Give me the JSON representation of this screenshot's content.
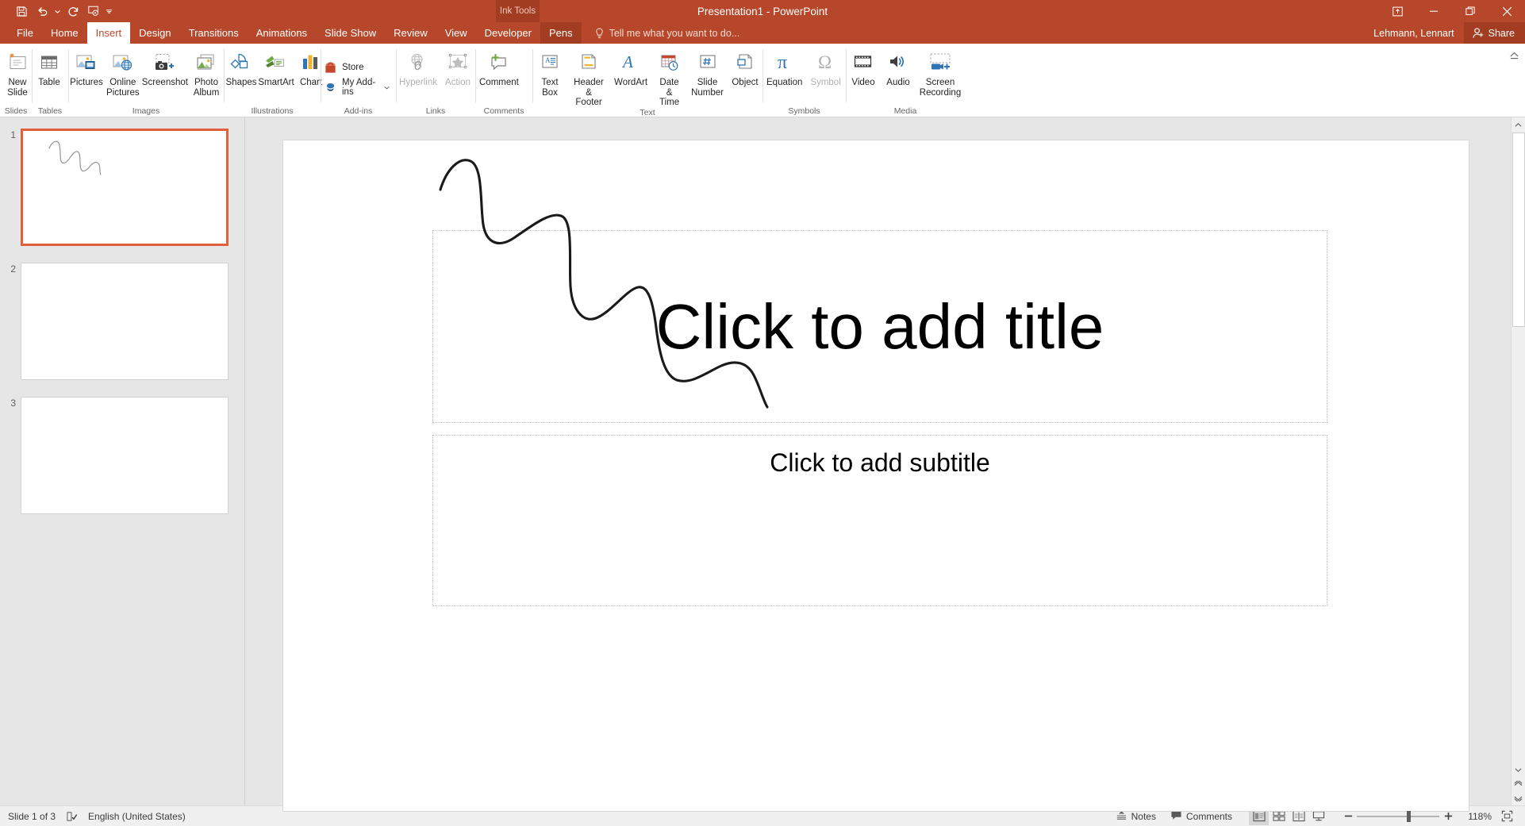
{
  "app": {
    "brand_color": "#B7472A",
    "brand_dark": "#A33D22",
    "accent_select": "#E1603C",
    "window_title": "Presentation1 - PowerPoint"
  },
  "quick_access": {
    "items": [
      {
        "name": "save-icon",
        "label": "Save"
      },
      {
        "name": "undo-icon",
        "label": "Undo"
      },
      {
        "name": "redo-icon",
        "label": "Redo"
      },
      {
        "name": "start-presentation-icon",
        "label": "Start From Beginning"
      },
      {
        "name": "customize-qat-icon",
        "label": "Customize Quick Access Toolbar"
      }
    ]
  },
  "contextual": {
    "ink_tools_label": "Ink Tools"
  },
  "window_controls": {
    "ribbon_display_label": "Ribbon Display Options",
    "minimize_label": "Minimize",
    "restore_label": "Restore Down",
    "close_label": "Close"
  },
  "tabs": [
    {
      "label": "File",
      "active": false
    },
    {
      "label": "Home",
      "active": false
    },
    {
      "label": "Insert",
      "active": true
    },
    {
      "label": "Design",
      "active": false
    },
    {
      "label": "Transitions",
      "active": false
    },
    {
      "label": "Animations",
      "active": false
    },
    {
      "label": "Slide Show",
      "active": false
    },
    {
      "label": "Review",
      "active": false
    },
    {
      "label": "View",
      "active": false
    },
    {
      "label": "Developer",
      "active": false
    },
    {
      "label": "Pens",
      "active": false,
      "contextual": true
    }
  ],
  "tellme": {
    "placeholder": "Tell me what you want to do..."
  },
  "account": {
    "user_name": "Lehmann, Lennart",
    "share_label": "Share"
  },
  "ribbon": {
    "collapse_label": "Collapse the Ribbon",
    "groups": [
      {
        "label": "Slides",
        "buttons": [
          {
            "label": "New\nSlide",
            "icon": "new-slide-icon",
            "dropdown": true,
            "disabled": false
          }
        ]
      },
      {
        "label": "Tables",
        "buttons": [
          {
            "label": "Table",
            "icon": "table-icon",
            "dropdown": true,
            "disabled": false
          }
        ]
      },
      {
        "label": "Images",
        "buttons": [
          {
            "label": "Pictures",
            "icon": "pictures-icon",
            "dropdown": false,
            "disabled": false
          },
          {
            "label": "Online\nPictures",
            "icon": "online-pictures-icon",
            "dropdown": false,
            "disabled": false
          },
          {
            "label": "Screenshot",
            "icon": "screenshot-icon",
            "dropdown": true,
            "disabled": false
          },
          {
            "label": "Photo\nAlbum",
            "icon": "photo-album-icon",
            "dropdown": true,
            "disabled": false
          }
        ]
      },
      {
        "label": "Illustrations",
        "buttons": [
          {
            "label": "Shapes",
            "icon": "shapes-icon",
            "dropdown": true,
            "disabled": false
          },
          {
            "label": "SmartArt",
            "icon": "smartart-icon",
            "dropdown": false,
            "disabled": false
          },
          {
            "label": "Chart",
            "icon": "chart-icon",
            "dropdown": false,
            "disabled": false
          }
        ]
      },
      {
        "label": "Add-ins",
        "small_buttons": [
          {
            "label": "Store",
            "icon": "store-icon",
            "dropdown": false
          },
          {
            "label": "My Add-ins",
            "icon": "my-addins-icon",
            "dropdown": true
          }
        ]
      },
      {
        "label": "Links",
        "buttons": [
          {
            "label": "Hyperlink",
            "icon": "hyperlink-icon",
            "dropdown": false,
            "disabled": true
          },
          {
            "label": "Action",
            "icon": "action-icon",
            "dropdown": false,
            "disabled": true
          }
        ]
      },
      {
        "label": "Comments",
        "buttons": [
          {
            "label": "Comment",
            "icon": "comment-icon",
            "dropdown": false,
            "disabled": false
          }
        ]
      },
      {
        "label": "Text",
        "buttons": [
          {
            "label": "Text\nBox",
            "icon": "text-box-icon",
            "dropdown": false,
            "disabled": false
          },
          {
            "label": "Header\n& Footer",
            "icon": "header-footer-icon",
            "dropdown": false,
            "disabled": false
          },
          {
            "label": "WordArt",
            "icon": "wordart-icon",
            "dropdown": true,
            "disabled": false
          },
          {
            "label": "Date &\nTime",
            "icon": "date-time-icon",
            "dropdown": false,
            "disabled": false
          },
          {
            "label": "Slide\nNumber",
            "icon": "slide-number-icon",
            "dropdown": false,
            "disabled": false
          },
          {
            "label": "Object",
            "icon": "object-icon",
            "dropdown": false,
            "disabled": false
          }
        ]
      },
      {
        "label": "Symbols",
        "buttons": [
          {
            "label": "Equation",
            "icon": "equation-icon",
            "dropdown": true,
            "disabled": false
          },
          {
            "label": "Symbol",
            "icon": "symbol-icon",
            "dropdown": false,
            "disabled": true
          }
        ]
      },
      {
        "label": "Media",
        "buttons": [
          {
            "label": "Video",
            "icon": "video-icon",
            "dropdown": true,
            "disabled": false
          },
          {
            "label": "Audio",
            "icon": "audio-icon",
            "dropdown": true,
            "disabled": false
          },
          {
            "label": "Screen\nRecording",
            "icon": "screen-recording-icon",
            "dropdown": false,
            "disabled": false
          }
        ]
      }
    ]
  },
  "slides": [
    {
      "number": "1",
      "selected": true,
      "has_ink": true
    },
    {
      "number": "2",
      "selected": false,
      "has_ink": false
    },
    {
      "number": "3",
      "selected": false,
      "has_ink": false
    }
  ],
  "slide": {
    "title_placeholder": "Click to add title",
    "subtitle_placeholder": "Click to add subtitle",
    "ink_color": "#1a1a1a"
  },
  "status": {
    "slide_counter": "Slide 1 of 3",
    "spellcheck_label": "Spelling and Grammar Check",
    "language": "English (United States)",
    "notes_label": "Notes",
    "comments_label": "Comments",
    "views": [
      {
        "name": "normal-view",
        "label": "Normal",
        "active": true
      },
      {
        "name": "slide-sorter-view",
        "label": "Slide Sorter",
        "active": false
      },
      {
        "name": "reading-view",
        "label": "Reading View",
        "active": false
      },
      {
        "name": "slide-show-view",
        "label": "Slide Show",
        "active": false
      }
    ],
    "zoom_out_label": "Zoom Out",
    "zoom_in_label": "Zoom In",
    "zoom_level": "118%",
    "fit_label": "Fit slide to current window"
  }
}
